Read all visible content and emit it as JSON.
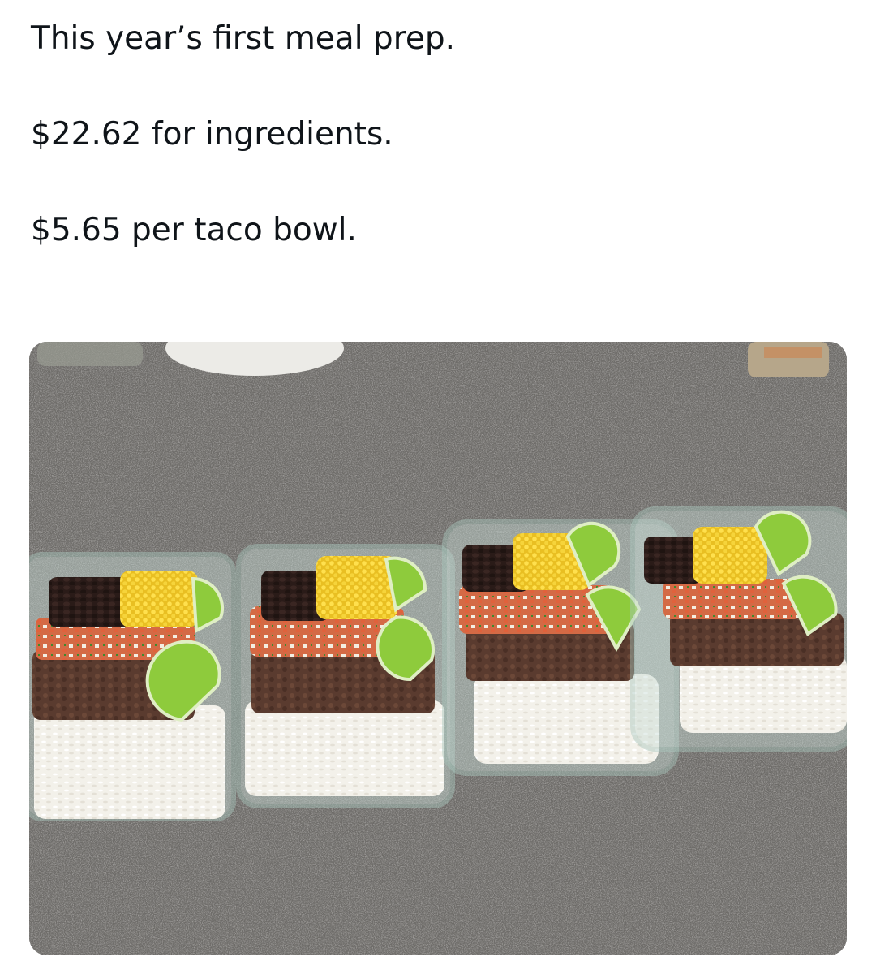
{
  "post": {
    "lines": [
      "This year’s first meal prep.",
      "$22.62 for ingredients.",
      "$5.65 per taco bowl."
    ]
  },
  "media": {
    "colors": {
      "countertop": "#6d6b68",
      "rice": "#f3f1ea",
      "beef": "#5a3b2f",
      "beans": "#2a1b18",
      "corn": "#f3cf2e",
      "tomato": "#e0623c",
      "onion": "#f4eee2",
      "lime": "#8ecb3c",
      "glass": "#c9dcd6"
    }
  }
}
